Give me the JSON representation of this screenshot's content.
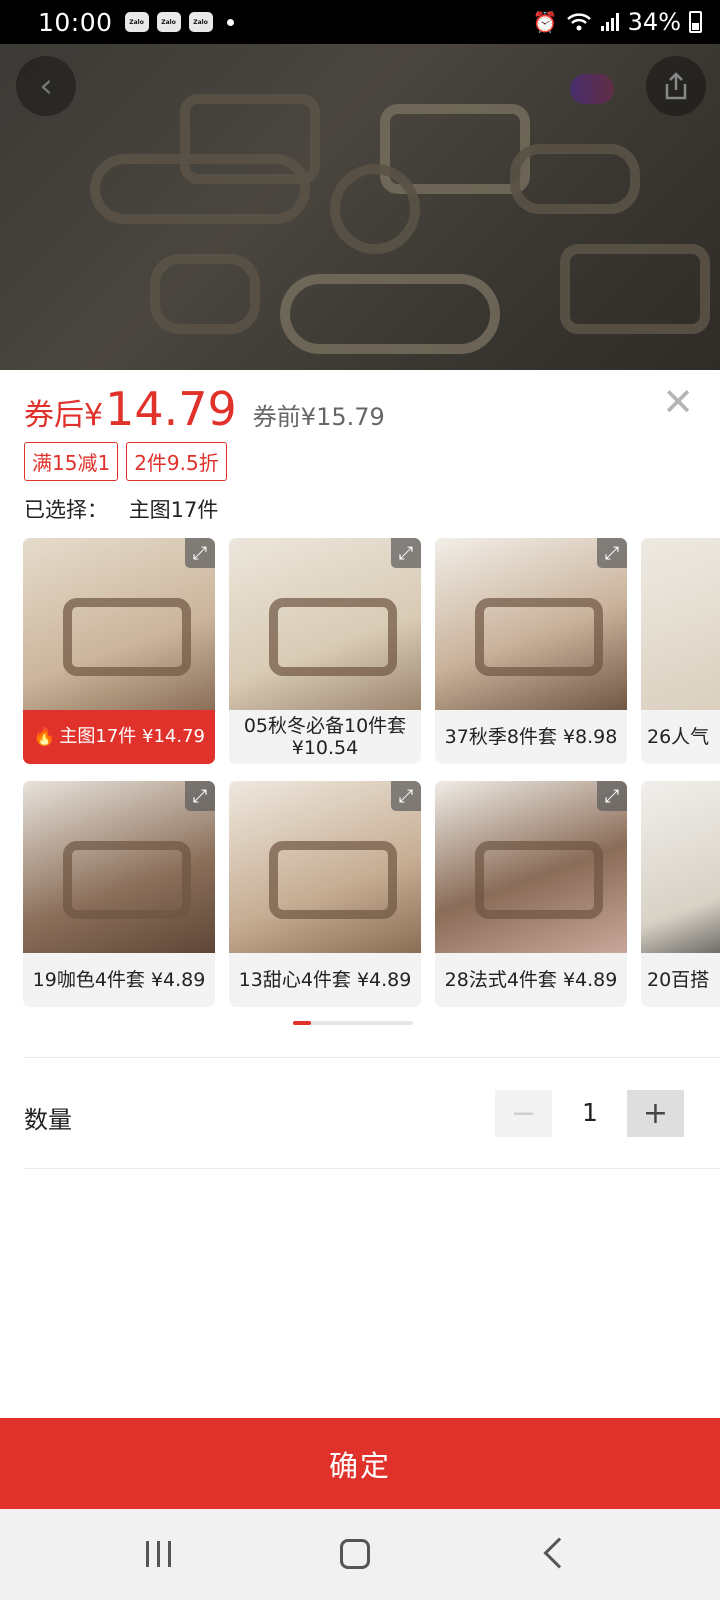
{
  "status_bar": {
    "time": "10:00",
    "notifications": [
      "Zalo",
      "Zalo",
      "Zalo"
    ],
    "battery": "34%"
  },
  "hero": {
    "back_icon": "chevron-left-icon",
    "share_icon": "share-icon"
  },
  "price": {
    "after_coupon_prefix": "券后¥",
    "after_coupon_value": "14.79",
    "before_coupon": "券前¥15.79"
  },
  "promo_tags": [
    "满15减1",
    "2件9.5折"
  ],
  "selection": {
    "label": "已选择：",
    "value": "主图17件"
  },
  "options": [
    {
      "label": "主图17件 ¥14.79",
      "selected": true
    },
    {
      "label": "05秋冬必备10件套 ¥10.54",
      "selected": false
    },
    {
      "label": "37秋季8件套 ¥8.98",
      "selected": false
    },
    {
      "label": "26人气",
      "selected": false
    },
    {
      "label": "19咖色4件套 ¥4.89",
      "selected": false
    },
    {
      "label": "13甜心4件套 ¥4.89",
      "selected": false
    },
    {
      "label": "28法式4件套 ¥4.89",
      "selected": false
    },
    {
      "label": "20百搭",
      "selected": false
    }
  ],
  "quantity": {
    "label": "数量",
    "value": "1",
    "minus": "−",
    "plus": "+"
  },
  "confirm_label": "确定",
  "colors": {
    "accent": "#e0322b"
  }
}
